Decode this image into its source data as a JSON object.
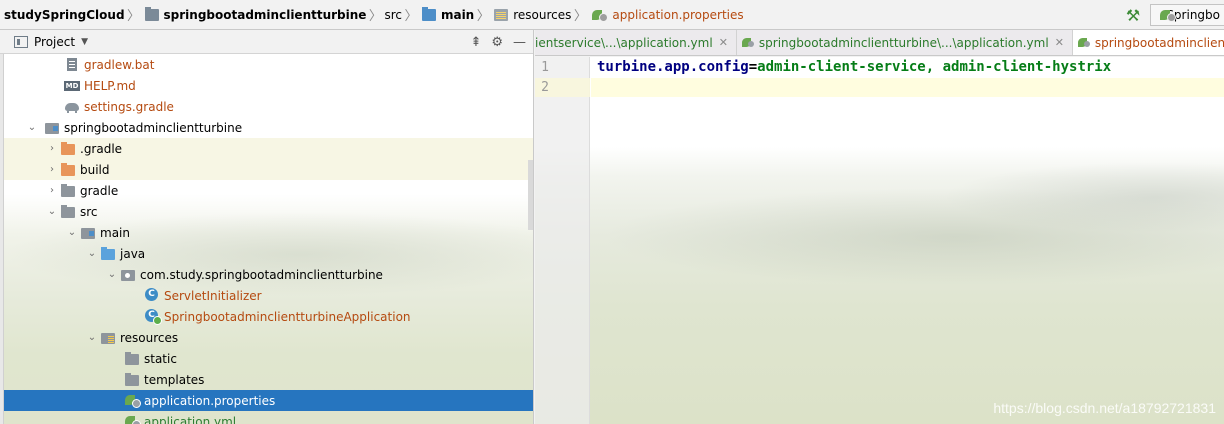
{
  "breadcrumb": {
    "items": [
      {
        "label": "studySpringCloud"
      },
      {
        "label": "springbootadminclientturbine"
      },
      {
        "label": "src"
      },
      {
        "label": "main"
      },
      {
        "label": "resources"
      },
      {
        "label": "application.properties"
      }
    ],
    "run_config": "Springbo"
  },
  "project_panel": {
    "title": "Project",
    "tree": [
      {
        "label": "gradlew.bat"
      },
      {
        "label": "HELP.md"
      },
      {
        "label": "settings.gradle"
      },
      {
        "label": "springbootadminclientturbine"
      },
      {
        "label": ".gradle"
      },
      {
        "label": "build"
      },
      {
        "label": "gradle"
      },
      {
        "label": "src"
      },
      {
        "label": "main"
      },
      {
        "label": "java"
      },
      {
        "label": "com.study.springbootadminclientturbine"
      },
      {
        "label": "ServletInitializer"
      },
      {
        "label": "SpringbootadminclientturbineApplication"
      },
      {
        "label": "resources"
      },
      {
        "label": "static"
      },
      {
        "label": "templates"
      },
      {
        "label": "application.properties"
      },
      {
        "label": "application.yml"
      }
    ]
  },
  "tabs": [
    {
      "label": "ientservice\\...\\application.yml"
    },
    {
      "label": "springbootadminclientturbine\\...\\application.yml"
    },
    {
      "label": "springbootadminclientturbine"
    }
  ],
  "editor": {
    "line_numbers": [
      "1",
      "2"
    ],
    "line1_key": "turbine.app.config",
    "line1_eq": "=",
    "line1_value": "admin-client-service, admin-client-hystrix"
  },
  "watermark": "https://blog.csdn.net/a18792721831"
}
